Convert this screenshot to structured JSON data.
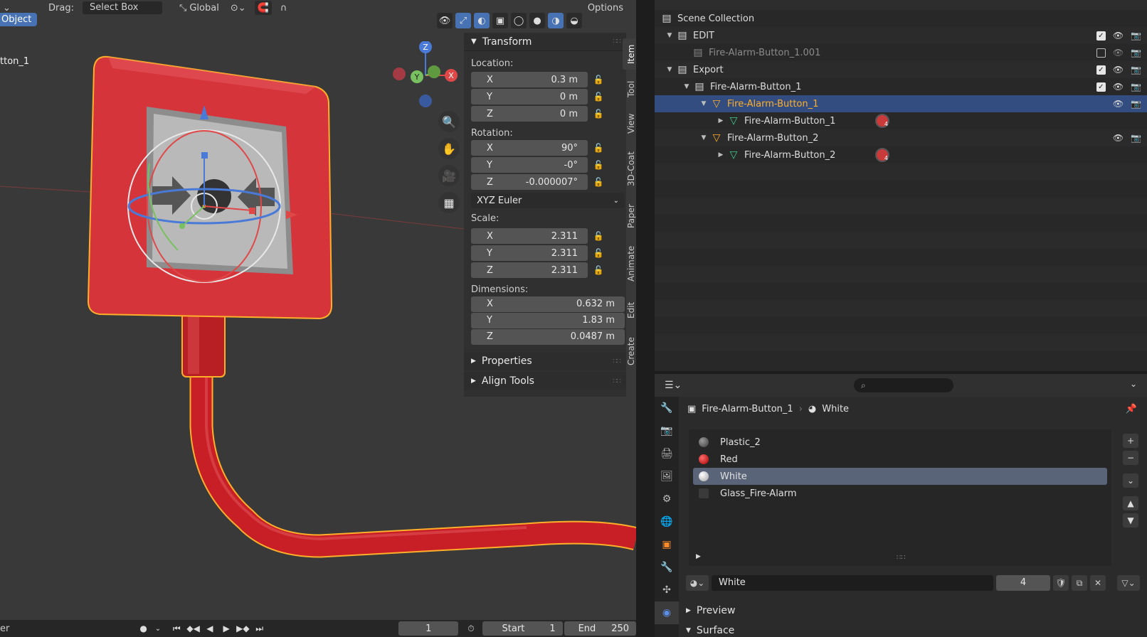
{
  "viewport": {
    "header": {
      "drag_label": "Drag:",
      "drag_value": "Select Box",
      "orientation_value": "Global",
      "options_label": "Options"
    },
    "mode_label": "Object",
    "object_name_overlay": "tton_1",
    "gizmo": {
      "z": "Z",
      "y": "Y",
      "x": "X"
    }
  },
  "npanel": {
    "transform_title": "Transform",
    "location_label": "Location:",
    "location": [
      {
        "axis": "X",
        "value": "0.3 m"
      },
      {
        "axis": "Y",
        "value": "0 m"
      },
      {
        "axis": "Z",
        "value": "0 m"
      }
    ],
    "rotation_label": "Rotation:",
    "rotation": [
      {
        "axis": "X",
        "value": "90°"
      },
      {
        "axis": "Y",
        "value": "-0°"
      },
      {
        "axis": "Z",
        "value": "-0.000007°"
      }
    ],
    "rotation_mode": "XYZ Euler",
    "scale_label": "Scale:",
    "scale": [
      {
        "axis": "X",
        "value": "2.311"
      },
      {
        "axis": "Y",
        "value": "2.311"
      },
      {
        "axis": "Z",
        "value": "2.311"
      }
    ],
    "dimensions_label": "Dimensions:",
    "dimensions": [
      {
        "axis": "X",
        "value": "0.632 m"
      },
      {
        "axis": "Y",
        "value": "1.83 m"
      },
      {
        "axis": "Z",
        "value": "0.0487 m"
      }
    ],
    "properties_title": "Properties",
    "align_tools_title": "Align Tools",
    "tabs": [
      "Item",
      "Tool",
      "View",
      "3D-Coat",
      "Paper",
      "Animate",
      "Edit",
      "Create"
    ]
  },
  "timeline": {
    "left_label": "er",
    "current_frame": "1",
    "start_label": "Start",
    "start_value": "1",
    "end_label": "End",
    "end_value": "250"
  },
  "outliner": {
    "rows": [
      {
        "label": "Scene Collection"
      },
      {
        "label": "EDIT"
      },
      {
        "label": "Fire-Alarm-Button_1.001"
      },
      {
        "label": "Export"
      },
      {
        "label": "Fire-Alarm-Button_1"
      },
      {
        "label": "Fire-Alarm-Button_1"
      },
      {
        "label": "Fire-Alarm-Button_1",
        "badge": "4"
      },
      {
        "label": "Fire-Alarm-Button_2"
      },
      {
        "label": "Fire-Alarm-Button_2",
        "badge": "4"
      }
    ]
  },
  "properties": {
    "breadcrumb_object": "Fire-Alarm-Button_1",
    "breadcrumb_material": "White",
    "slots": [
      "Plastic_2",
      "Red",
      "White",
      "Glass_Fire-Alarm"
    ],
    "material_name": "White",
    "material_users": "4",
    "preview_title": "Preview",
    "surface_title": "Surface"
  },
  "colors": {
    "accent": "#4772b3",
    "selection_orange": "#ffaf29",
    "object_red": "#d5343b"
  }
}
